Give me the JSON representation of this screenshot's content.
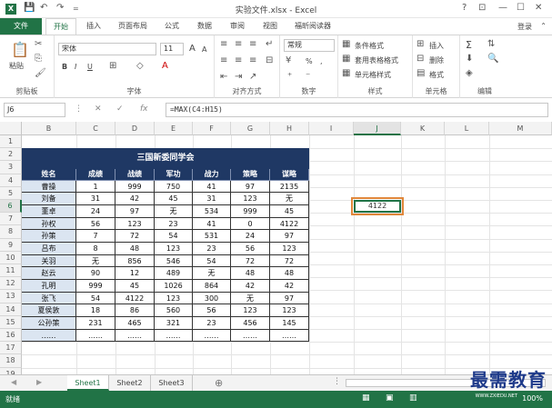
{
  "titlebar": {
    "title": "实验文件.xlsx - Excel",
    "logo": "X",
    "help": "?",
    "ribbon_display": "⊡",
    "minimize": "—",
    "restore": "☐",
    "close": "✕",
    "save_icon": "save-icon",
    "undo_icon": "undo-icon",
    "redo_icon": "redo-icon"
  },
  "tabs": {
    "file": "文件",
    "items": [
      "开始",
      "插入",
      "页面布局",
      "公式",
      "数据",
      "审阅",
      "视图",
      "福昕阅读器"
    ],
    "active": "开始",
    "login": "登录"
  },
  "ribbon": {
    "clipboard": {
      "label": "剪贴板",
      "paste": "粘贴"
    },
    "font": {
      "label": "字体",
      "name": "宋体",
      "size": "11",
      "bold": "B",
      "italic": "I",
      "underline": "U",
      "grow": "A",
      "shrink": "A"
    },
    "alignment": {
      "label": "对齐方式"
    },
    "number": {
      "label": "数字",
      "format": "常规",
      "percent": "%",
      "comma": ","
    },
    "styles": {
      "label": "样式",
      "conditional": "条件格式",
      "table": "套用表格格式",
      "cell": "单元格样式"
    },
    "cells": {
      "label": "单元格",
      "insert": "插入",
      "delete": "删除",
      "format": "格式"
    },
    "editing": {
      "label": "编辑",
      "sum": "Σ"
    }
  },
  "formulabar": {
    "namebox": "J6",
    "cancel": "✕",
    "enter": "✓",
    "fx": "fx",
    "formula": "=MAX(C4:H15)"
  },
  "columns": [
    "B",
    "C",
    "D",
    "E",
    "F",
    "G",
    "H",
    "I",
    "J",
    "K",
    "L",
    "M"
  ],
  "rows": [
    "1",
    "2",
    "3",
    "4",
    "5",
    "6",
    "7",
    "8",
    "9",
    "10",
    "11",
    "12",
    "13",
    "14",
    "15",
    "16",
    "17",
    "18",
    "19"
  ],
  "table": {
    "title": "三国新委同学会",
    "headers": [
      "姓名",
      "成绩",
      "战绩",
      "军功",
      "战力",
      "策略",
      "谋略"
    ],
    "rows": [
      [
        "曹操",
        "1",
        "999",
        "750",
        "41",
        "97",
        "2135"
      ],
      [
        "刘备",
        "31",
        "42",
        "45",
        "31",
        "123",
        "无"
      ],
      [
        "董卓",
        "24",
        "97",
        "无",
        "534",
        "999",
        "45"
      ],
      [
        "孙权",
        "56",
        "123",
        "23",
        "41",
        "0",
        "4122"
      ],
      [
        "孙策",
        "7",
        "72",
        "54",
        "531",
        "24",
        "97"
      ],
      [
        "吕布",
        "8",
        "48",
        "123",
        "23",
        "56",
        "123"
      ],
      [
        "关羽",
        "无",
        "856",
        "546",
        "54",
        "72",
        "72"
      ],
      [
        "赵云",
        "90",
        "12",
        "489",
        "无",
        "48",
        "48"
      ],
      [
        "孔明",
        "999",
        "45",
        "1026",
        "864",
        "42",
        "42"
      ],
      [
        "张飞",
        "54",
        "4122",
        "123",
        "300",
        "无",
        "97"
      ],
      [
        "夏侯敦",
        "18",
        "86",
        "560",
        "56",
        "123",
        "123"
      ],
      [
        "公孙策",
        "231",
        "465",
        "321",
        "23",
        "456",
        "145"
      ],
      [
        "……",
        "……",
        "……",
        "……",
        "……",
        "……",
        "……"
      ]
    ]
  },
  "result": {
    "cell": "J6",
    "value": "4122"
  },
  "sheets": [
    "Sheet1",
    "Sheet2",
    "Sheet3"
  ],
  "active_sheet": "Sheet1",
  "add_sheet": "⊕",
  "status": {
    "ready": "就绪",
    "zoom": "100%"
  },
  "watermark": {
    "text": "最需教育",
    "sub": "WWW.ZXIEDU.NET"
  }
}
